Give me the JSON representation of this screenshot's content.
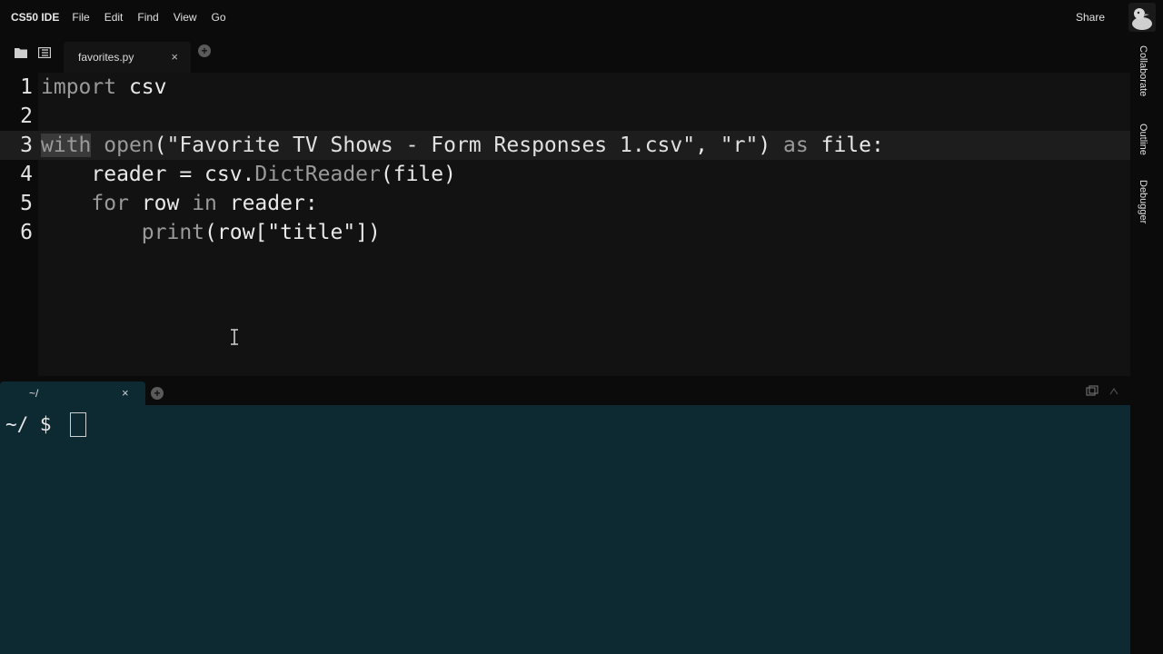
{
  "menubar": {
    "brand": "CS50 IDE",
    "items": [
      "File",
      "Edit",
      "Find",
      "View",
      "Go"
    ],
    "share_label": "Share",
    "avatar_icon": "duck-avatar-icon"
  },
  "editor": {
    "tab": {
      "label": "favorites.py",
      "close": "×"
    },
    "lines": [
      {
        "number": "1",
        "tokens": [
          {
            "t": "import",
            "c": "kw"
          },
          {
            "t": " csv",
            "c": ""
          }
        ]
      },
      {
        "number": "2",
        "tokens": []
      },
      {
        "number": "3",
        "active": true,
        "tokens": [
          {
            "t": "with",
            "c": "kw-sel"
          },
          {
            "t": " ",
            "c": ""
          },
          {
            "t": "open",
            "c": "kw"
          },
          {
            "t": "(",
            "c": ""
          },
          {
            "t": "\"Favorite TV Shows - Form Responses 1.csv\"",
            "c": "str"
          },
          {
            "t": ", ",
            "c": ""
          },
          {
            "t": "\"r\"",
            "c": "str"
          },
          {
            "t": ") ",
            "c": ""
          },
          {
            "t": "as",
            "c": "kw"
          },
          {
            "t": " file:",
            "c": ""
          }
        ]
      },
      {
        "number": "4",
        "tokens": [
          {
            "t": "    reader = csv.",
            "c": ""
          },
          {
            "t": "DictReader",
            "c": "kw"
          },
          {
            "t": "(file)",
            "c": ""
          }
        ]
      },
      {
        "number": "5",
        "tokens": [
          {
            "t": "    ",
            "c": ""
          },
          {
            "t": "for",
            "c": "kw"
          },
          {
            "t": " row ",
            "c": ""
          },
          {
            "t": "in",
            "c": "kw"
          },
          {
            "t": " reader:",
            "c": ""
          }
        ]
      },
      {
        "number": "6",
        "tokens": [
          {
            "t": "        ",
            "c": ""
          },
          {
            "t": "print",
            "c": "kw"
          },
          {
            "t": "(row[\"title\"])",
            "c": ""
          }
        ]
      }
    ]
  },
  "right_panel": {
    "tabs": [
      "Collaborate",
      "Outline",
      "Debugger"
    ]
  },
  "terminal": {
    "tab": {
      "label": "~/",
      "close": "×"
    },
    "prompt": "~/ $"
  },
  "colors": {
    "terminal_bg": "#0d2a33",
    "editor_bg": "#121212",
    "chrome_bg": "#0b0b0b"
  }
}
